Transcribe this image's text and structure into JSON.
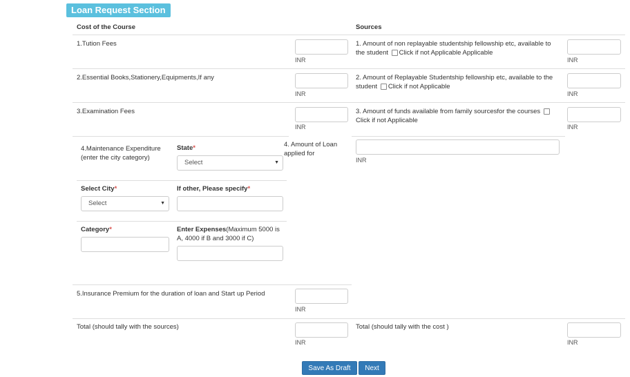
{
  "section_title": "Loan Request Section",
  "cost_header": "Cost of the Course",
  "sources_header": "Sources",
  "unit": "INR",
  "cost": {
    "tuition": "1.Tution Fees",
    "books": "2.Essential Books,Stationery,Equipments,If any",
    "exam": "3.Examination Fees",
    "maintenance": "4.Maintenance Expenditure (enter the city category)",
    "state_label": "State",
    "state_value": "Select",
    "city_label": "Select City",
    "city_value": "Select",
    "other_label": "If other, Please specify",
    "category_label": "Category",
    "expenses_label": "Enter Expenses",
    "expenses_note": "(Maximum 5000 is A, 4000 if B and 3000 if C)",
    "insurance": "5.Insurance Premium for the duration of loan and Start up Period",
    "total": "Total (should tally with the sources)"
  },
  "sources": {
    "s1": "1. Amount of non replayable studentship fellowship etc, available to the student",
    "s1_chk": "Click if not Applicable Applicable",
    "s2": "2. Amount of Replayable Studentship fellowship etc, available to the student",
    "s2_chk": "Click if not Applicable",
    "s3": "3. Amount of funds available from family sourcesfor the courses",
    "s3_chk": "Click if not Applicable",
    "s4": "4. Amount of Loan applied for",
    "total": "Total (should tally with the cost )"
  },
  "buttons": {
    "draft": "Save As Draft",
    "next": "Next"
  }
}
